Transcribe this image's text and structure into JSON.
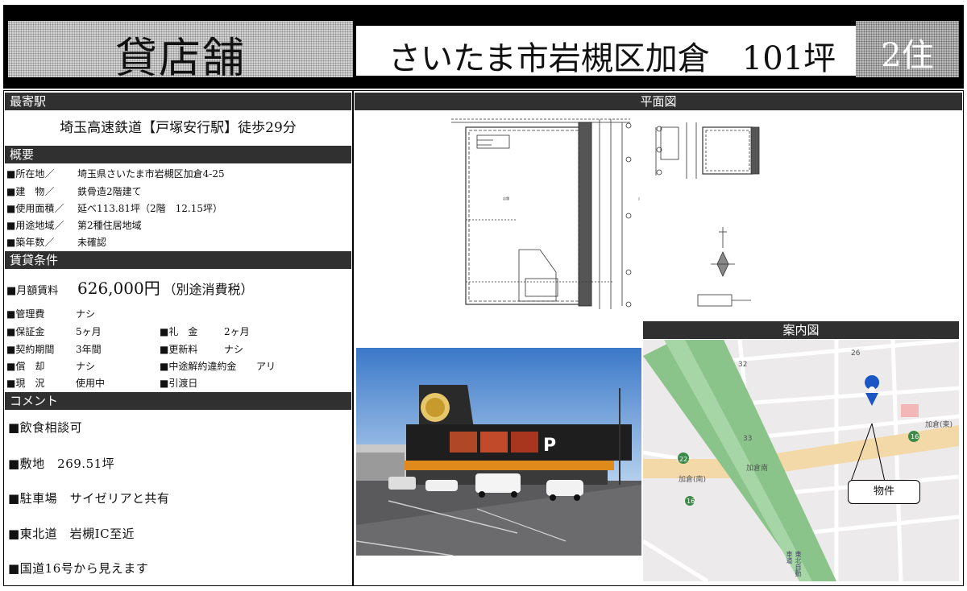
{
  "header": {
    "title": "貸店舗",
    "location_size": "さいたま市岩槻区加倉　101坪",
    "zone_badge": "2住"
  },
  "sections": {
    "nearest_station": "最寄駅",
    "overview": "概要",
    "lease_terms": "賃貸条件",
    "comment": "コメント",
    "floor_plan": "平面図",
    "guide_map": "案内図"
  },
  "station": "埼玉高速鉄道【戸塚安行駅】徒歩29分",
  "overview": [
    {
      "label": "■所在地／",
      "value": "埼玉県さいたま市岩槻区加倉4-25"
    },
    {
      "label": "■建　物／",
      "value": "鉄骨造2階建て"
    },
    {
      "label": "■使用面積／",
      "value": "延べ113.81坪（2階　12.15坪）"
    },
    {
      "label": "■用途地域／",
      "value": "第2種住居地域"
    },
    {
      "label": "■築年数／",
      "value": "未確認"
    }
  ],
  "terms": {
    "rent_label": "■月額賃料",
    "rent_value": "626,000円",
    "rent_note": "（別途消費税）",
    "items": [
      {
        "label": "■管理費",
        "value": "ナシ"
      },
      {
        "label": "■保証金",
        "value": "5ヶ月",
        "label2": "■礼　金",
        "value2": "2ヶ月"
      },
      {
        "label": "■契約期間",
        "value": "3年間",
        "label2": "■更新料",
        "value2": "ナシ"
      },
      {
        "label": "■償　却",
        "value": "ナシ",
        "label2": "■中途解約違約金",
        "value2": "アリ"
      },
      {
        "label": "■現　況",
        "value": "使用中",
        "label2": "■引渡日",
        "value2": ""
      }
    ]
  },
  "comments": [
    "■飲食相談可",
    "■敷地　269.51坪",
    "■駐車場　サイゼリアと共有",
    "■東北道　岩槻IC至近",
    "■国道16号から見えます"
  ],
  "map": {
    "marker_label": "物件",
    "labels": [
      "26",
      "32",
      "33",
      "加倉(東)",
      "加倉南",
      "加倉(南)",
      "122",
      "16",
      "16",
      "東北自動車道"
    ]
  },
  "colors": {
    "bar_bg": "#303030",
    "header_bg": "#000000",
    "map_highway": "#8bc48a",
    "map_road": "#f3d9a8",
    "marker": "#1a56c4"
  }
}
